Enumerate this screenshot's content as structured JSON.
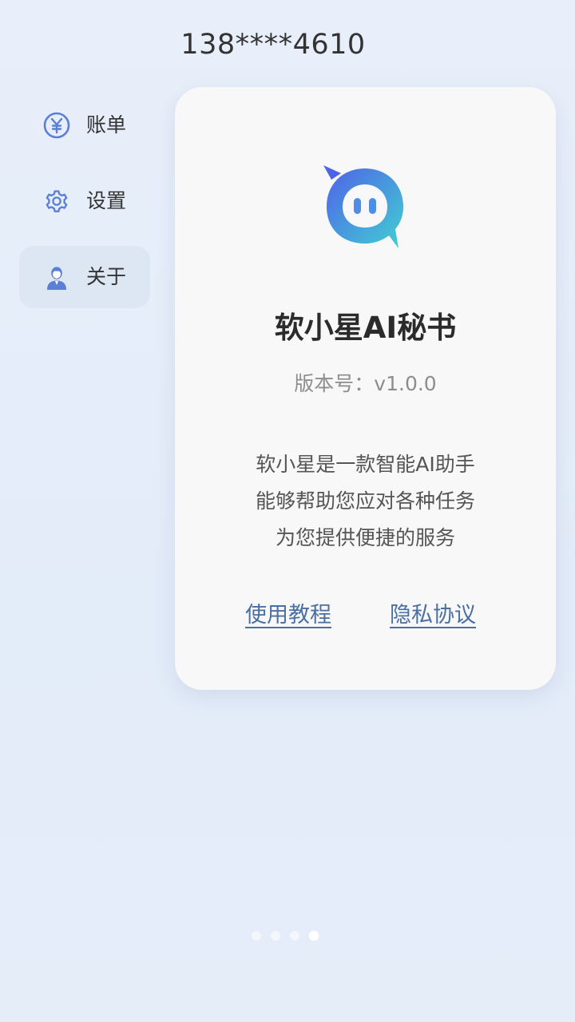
{
  "header": {
    "phone": "138****4610"
  },
  "sidebar": {
    "items": [
      {
        "label": "账单",
        "icon": "yen-icon",
        "active": false
      },
      {
        "label": "设置",
        "icon": "gear-icon",
        "active": false
      },
      {
        "label": "关于",
        "icon": "user-icon",
        "active": true
      }
    ]
  },
  "about": {
    "logo_icon": "chat-bubble-logo-icon",
    "app_name": "软小星AI秘书",
    "version": "版本号：v1.0.0",
    "description_lines": [
      "软小星是一款智能AI助手",
      "能够帮助您应对各种任务",
      "为您提供便捷的服务"
    ],
    "links": {
      "tutorial": "使用教程",
      "privacy": "隐私协议"
    }
  },
  "pager": {
    "count": 4,
    "active_index": 3
  },
  "colors": {
    "accent": "#5b7fd6",
    "link": "#4a6fa3",
    "logo_gradient_start": "#4f63e8",
    "logo_gradient_end": "#41d0d2",
    "background": "#e6eef9"
  }
}
